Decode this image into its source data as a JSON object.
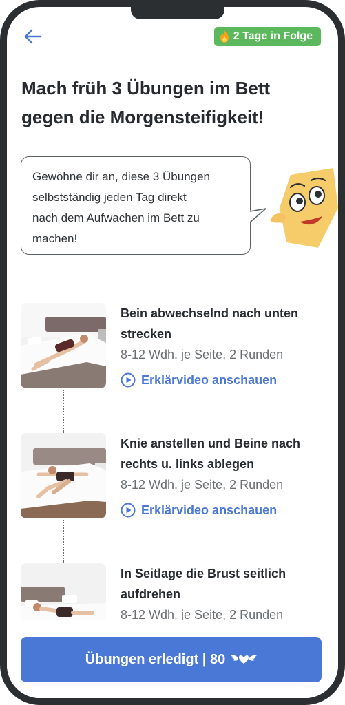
{
  "header": {
    "back_icon": "arrow-left-icon",
    "streak": {
      "label": "2 Tage in Folge",
      "icon": "flame-icon",
      "color": "#5cb85c"
    }
  },
  "title": {
    "line1": "Mach früh 3 Übungen im Bett",
    "line2": "gegen die Morgensteifigkeit!"
  },
  "bubble": {
    "lines": [
      "Gewöhne dir an, diese 3 Übungen",
      "selbstständig jeden Tag direkt",
      "nach dem Aufwachen im Bett zu",
      "machen!"
    ]
  },
  "exercises": [
    {
      "title_lines": [
        "Bein abwechselnd nach unten",
        "strecken"
      ],
      "reps": "8-12 Wdh. je Seite, 2 Runden",
      "video_label": "Erklärvideo anschauen"
    },
    {
      "title_lines": [
        "Knie anstellen und Beine nach",
        "rechts u. links ablegen"
      ],
      "reps": "8-12 Wdh. je Seite, 2 Runden",
      "video_label": "Erklärvideo anschauen"
    },
    {
      "title_lines": [
        "In Seitlage die Brust seitlich",
        "aufdrehen"
      ],
      "reps": "8-12 Wdh. je Seite, 2 Runden"
    }
  ],
  "footer": {
    "button_label": "Übungen erledigt | 80",
    "button_icon": "wings-icon",
    "accent": "#4a78d6"
  }
}
